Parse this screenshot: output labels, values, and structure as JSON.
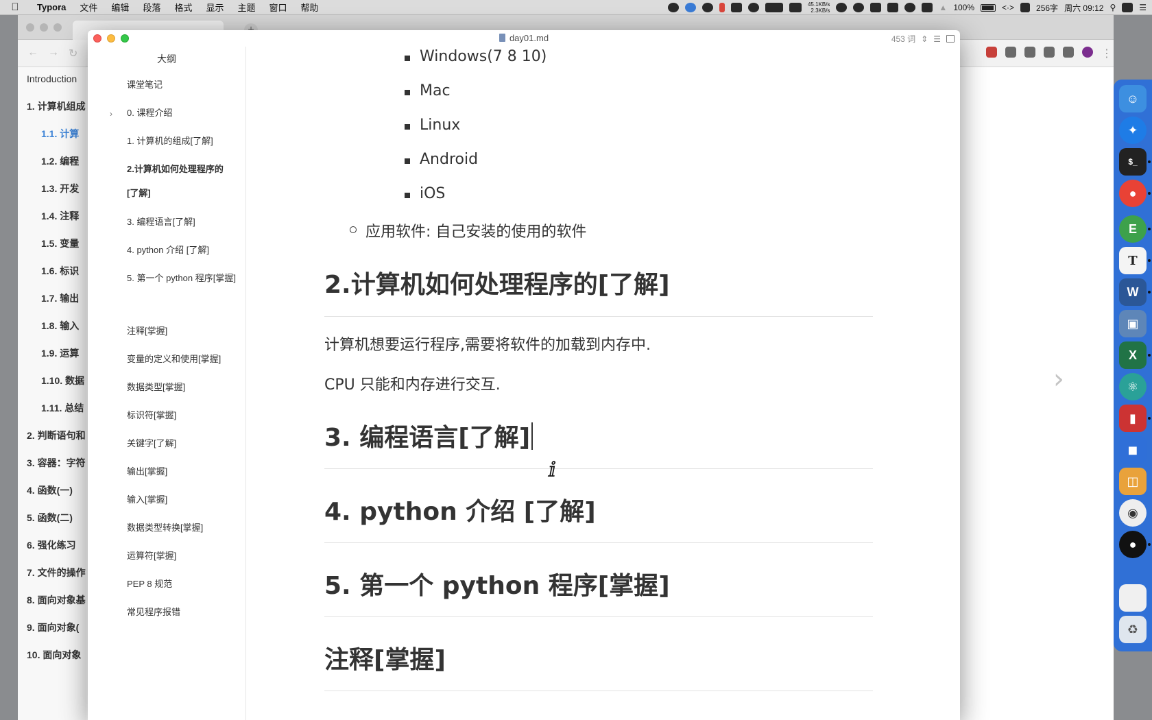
{
  "menubar": {
    "app_name": "Typora",
    "items": [
      "文件",
      "编辑",
      "段落",
      "格式",
      "显示",
      "主题",
      "窗口",
      "帮助"
    ],
    "net_up": "45.1KB/s",
    "net_down": "2.3KB/s",
    "battery": "100%",
    "word_count": "256字",
    "clock": "周六 09:12"
  },
  "window": {
    "title": "day01.md",
    "word_count_label": "453 词"
  },
  "outline": {
    "header": "大纲",
    "items": [
      {
        "label": "课堂笔记"
      },
      {
        "label": "0. 课程介绍"
      },
      {
        "label": "1. 计算机的组成[了解]"
      },
      {
        "label": "2.计算机如何处理程序的 [了解]"
      },
      {
        "label": "3. 编程语言[了解]"
      },
      {
        "label": "4. python 介绍 [了解]"
      },
      {
        "label": "5. 第一个 python 程序[掌握]"
      },
      {
        "label": "注释[掌握]"
      },
      {
        "label": "变量的定义和使用[掌握]"
      },
      {
        "label": "数据类型[掌握]"
      },
      {
        "label": "标识符[掌握]"
      },
      {
        "label": "关键字[了解]"
      },
      {
        "label": "输出[掌握]"
      },
      {
        "label": "输入[掌握]"
      },
      {
        "label": "数据类型转换[掌握]"
      },
      {
        "label": "运算符[掌握]"
      },
      {
        "label": "PEP 8 规范"
      },
      {
        "label": "常见程序报错"
      }
    ]
  },
  "content": {
    "os_list": [
      "Windows(7 8 10)",
      "Mac",
      "Linux",
      "Android",
      "iOS"
    ],
    "app_software": "应用软件: 自己安装的使用的软件",
    "h2_process": "2.计算机如何处理程序的[了解]",
    "p_memory": "计算机想要运行程序,需要将软件的加载到内存中.",
    "p_cpu": "CPU 只能和内存进行交互.",
    "h2_lang": "3. 编程语言[了解]",
    "h2_python": "4. python 介绍 [了解]",
    "h2_first": "5. 第一个 python 程序[掌握]",
    "h2_comment": "注释[掌握]"
  },
  "background_sidebar": {
    "items": [
      "Introduction",
      "1. 计算机组成",
      "1.1. 计算",
      "1.2. 编程",
      "1.3. 开发",
      "1.4. 注释",
      "1.5. 变量",
      "1.6. 标识",
      "1.7. 输出",
      "1.8. 输入",
      "1.9. 运算",
      "1.10. 数据",
      "1.11. 总结",
      "2. 判断语句和",
      "3. 容器：字符",
      "4. 函数(一)",
      "5. 函数(二)",
      "6. 强化练习",
      "7. 文件的操作",
      "8. 面向对象基",
      "9. 面向对象(",
      "10. 面向对象"
    ]
  },
  "colors": {
    "accent_link": "#3b82d6",
    "dock_bg": "#286edc",
    "close": "#fc605c",
    "minimize": "#fdbc40",
    "maximize": "#34c84a"
  }
}
